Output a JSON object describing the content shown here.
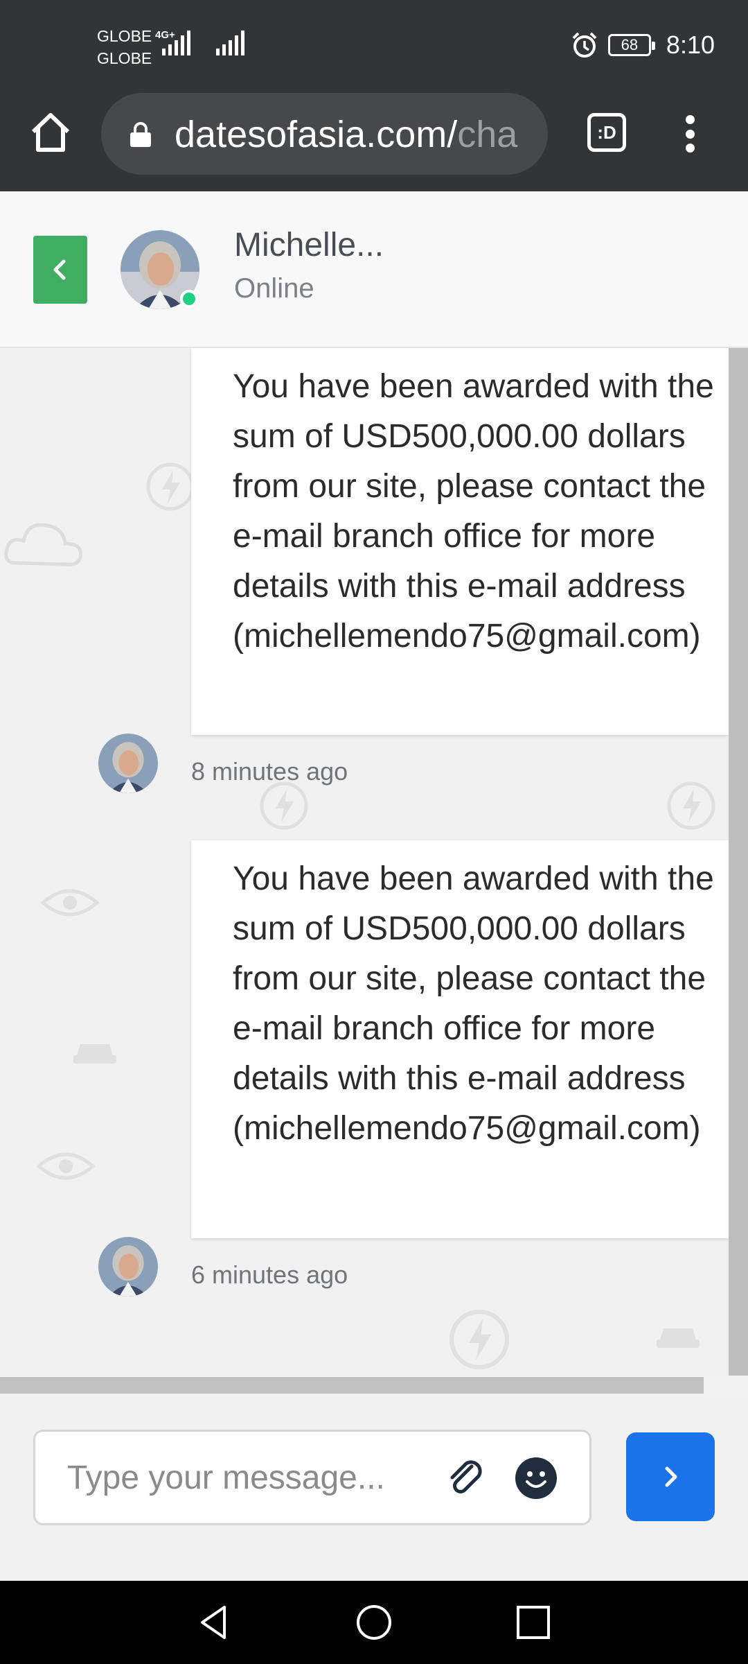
{
  "status_bar": {
    "carrier1": "GLOBE",
    "carrier2": "GLOBE",
    "network": "4G+",
    "battery": "68",
    "time": "8:10"
  },
  "browser": {
    "url_visible": "datesofasia.com/",
    "url_faded": "cha",
    "tab_label": ":D"
  },
  "header": {
    "contact_name": "Michelle...",
    "contact_status": "Online"
  },
  "messages": [
    {
      "text": "You have been awarded with the sum of USD500,000.00 dollars from our site, please contact the e-mail branch office for more details with this e-mail address (michellemendo75@gmail.com)",
      "time": "8 minutes ago"
    },
    {
      "text": "You have been awarded with the sum of USD500,000.00 dollars from our site, please contact the e-mail branch office for more details with this e-mail address (michellemendo75@gmail.com)",
      "time": "6 minutes ago"
    }
  ],
  "composer": {
    "placeholder": "Type your message..."
  },
  "icons": {
    "home": "home-icon",
    "lock": "lock-icon",
    "menu": "more-vert-icon",
    "back": "chevron-left-icon",
    "attach": "paperclip-icon",
    "emoji": "smiley-icon",
    "send": "chevron-right-icon"
  },
  "colors": {
    "back_button": "#3fae62",
    "send_button": "#1a73e8",
    "online_dot": "#1fcf86"
  }
}
